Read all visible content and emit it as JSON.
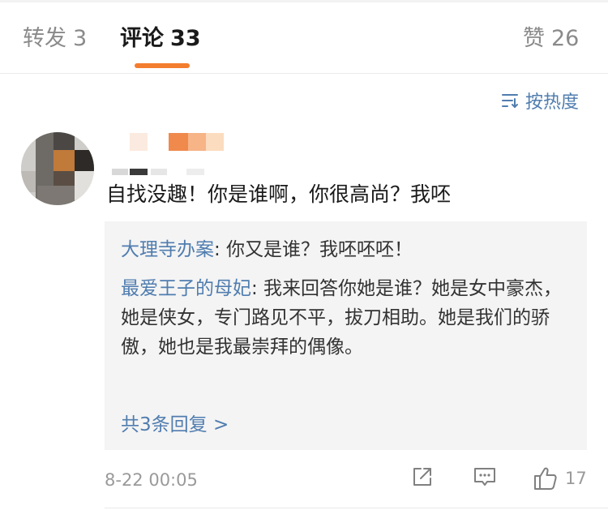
{
  "tabs": {
    "repost_label": "转发",
    "repost_count": "3",
    "comments_label": "评论",
    "comments_count": "33",
    "likes_label": "赞",
    "likes_count": "26"
  },
  "sort": {
    "label": "按热度",
    "icon": "sort-lines-icon"
  },
  "comment": {
    "text": "自找没趣！你是谁啊，你很高尚？我呸",
    "timestamp": "8-22 00:05",
    "like_count": "17"
  },
  "replies": [
    {
      "author": "大理寺办案",
      "text": ": 你又是谁？我呸呸呸！"
    },
    {
      "author": "最爱王子的母妃",
      "text": ": 我来回答你她是谁？她是女中豪杰，她是侠女，专门路见不平，拔刀相助。她是我们的骄傲，她也是我最崇拜的偶像。"
    }
  ],
  "more_replies": "共3条回复 >",
  "colors": {
    "accent": "#f37d2e",
    "link": "#507daf",
    "muted": "#9a9a9a",
    "reply_bg": "#f4f4f4"
  }
}
